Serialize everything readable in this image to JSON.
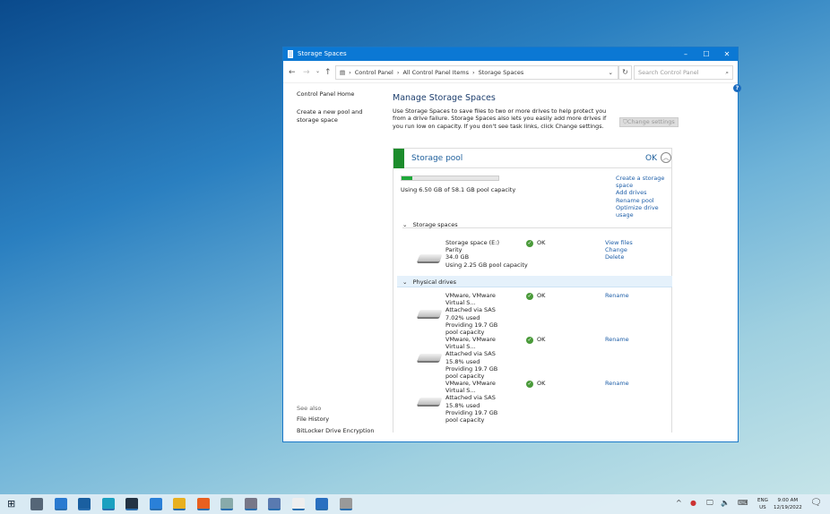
{
  "window": {
    "title": "Storage Spaces",
    "minimize": "–",
    "maximize": "☐",
    "close": "✕"
  },
  "address": {
    "crumbs": [
      "Control Panel",
      "All Control Panel Items",
      "Storage Spaces"
    ],
    "search_placeholder": "Search Control Panel"
  },
  "left_nav": {
    "items": [
      "Control Panel Home",
      "Create a new pool and storage space"
    ],
    "see_also": "See also",
    "see_also_items": [
      "File History",
      "BitLocker Drive Encryption"
    ]
  },
  "main": {
    "title": "Manage Storage Spaces",
    "description": "Use Storage Spaces to save files to two or more drives to help protect you from a drive failure. Storage Spaces also lets you easily add more drives if you run low on capacity. If you don't see task links, click Change settings.",
    "change_settings": "Change settings"
  },
  "pool": {
    "name": "Storage pool",
    "status": "OK",
    "usage_text": "Using 6.50 GB of 58.1 GB pool capacity",
    "usage_fraction": 0.112,
    "links": [
      "Create a storage space",
      "Add drives",
      "Rename pool",
      "Optimize drive usage"
    ],
    "storage_spaces_label": "Storage spaces",
    "space": {
      "name": "Storage space (E:)",
      "type": "Parity",
      "size": "34.0 GB",
      "usage": "Using 2.25 GB pool capacity",
      "status": "OK",
      "links": [
        "View files",
        "Change",
        "Delete"
      ]
    },
    "physical_label": "Physical drives",
    "drives": [
      {
        "name": "VMware, VMware Virtual S...",
        "attach": "Attached via SAS",
        "used": "7.02% used",
        "providing": "Providing 19.7 GB pool capacity",
        "status": "OK",
        "link": "Rename"
      },
      {
        "name": "VMware, VMware Virtual S...",
        "attach": "Attached via SAS",
        "used": "15.8% used",
        "providing": "Providing 19.7 GB pool capacity",
        "status": "OK",
        "link": "Rename"
      },
      {
        "name": "VMware, VMware Virtual S...",
        "attach": "Attached via SAS",
        "used": "15.8% used",
        "providing": "Providing 19.7 GB pool capacity",
        "status": "OK",
        "link": "Rename"
      }
    ]
  },
  "taskbar": {
    "lang": "ENG",
    "region": "US",
    "time": "9:00 AM",
    "date": "12/19/2022"
  },
  "colors": {
    "accent": "#0b78d4",
    "pool_green": "#1c8c2c"
  }
}
